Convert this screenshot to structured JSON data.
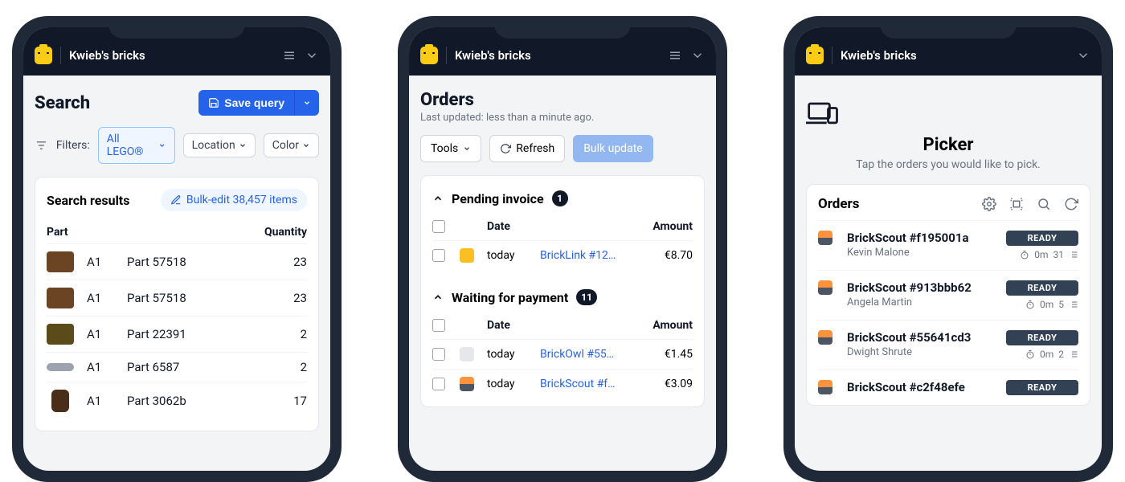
{
  "brand": "Kwieb's bricks",
  "search": {
    "title": "Search",
    "save_label": "Save query",
    "filters_label": "Filters:",
    "chip_all": "All LEGO®",
    "chip_location": "Location",
    "chip_color": "Color",
    "results_title": "Search results",
    "bulk_edit_label": "Bulk-edit 38,457 items",
    "col_part": "Part",
    "col_qty": "Quantity",
    "rows": [
      {
        "loc": "A1",
        "name": "Part 57518",
        "qty": "23"
      },
      {
        "loc": "A1",
        "name": "Part 57518",
        "qty": "23"
      },
      {
        "loc": "A1",
        "name": "Part 22391",
        "qty": "2"
      },
      {
        "loc": "A1",
        "name": "Part 6587",
        "qty": "2"
      },
      {
        "loc": "A1",
        "name": "Part 3062b",
        "qty": "17"
      }
    ]
  },
  "orders": {
    "title": "Orders",
    "subtitle": "Last updated: less than a minute ago.",
    "tools_label": "Tools",
    "refresh_label": "Refresh",
    "bulk_label": "Bulk update",
    "col_date": "Date",
    "col_amount": "Amount",
    "sections": [
      {
        "title": "Pending invoice",
        "count": "1",
        "rows": [
          {
            "date": "today",
            "link": "BrickLink #12…",
            "amount": "€8.70",
            "src": "bl"
          }
        ]
      },
      {
        "title": "Waiting for payment",
        "count": "11",
        "rows": [
          {
            "date": "today",
            "link": "BrickOwl #55…",
            "amount": "€1.45",
            "src": "owl"
          },
          {
            "date": "today",
            "link": "BrickScout #f…",
            "amount": "€3.09",
            "src": "scout"
          }
        ]
      }
    ]
  },
  "picker": {
    "title": "Picker",
    "subtitle": "Tap the orders you would like to pick.",
    "orders_label": "Orders",
    "ready_label": "READY",
    "items": [
      {
        "title": "BrickScout #f195001a",
        "customer": "Kevin Malone",
        "time": "0m",
        "count": "31"
      },
      {
        "title": "BrickScout #913bbb62",
        "customer": "Angela Martin",
        "time": "0m",
        "count": "5"
      },
      {
        "title": "BrickScout #55641cd3",
        "customer": "Dwight Shrute",
        "time": "0m",
        "count": "2"
      },
      {
        "title": "BrickScout #c2f48efe",
        "customer": "",
        "time": "",
        "count": ""
      }
    ]
  }
}
